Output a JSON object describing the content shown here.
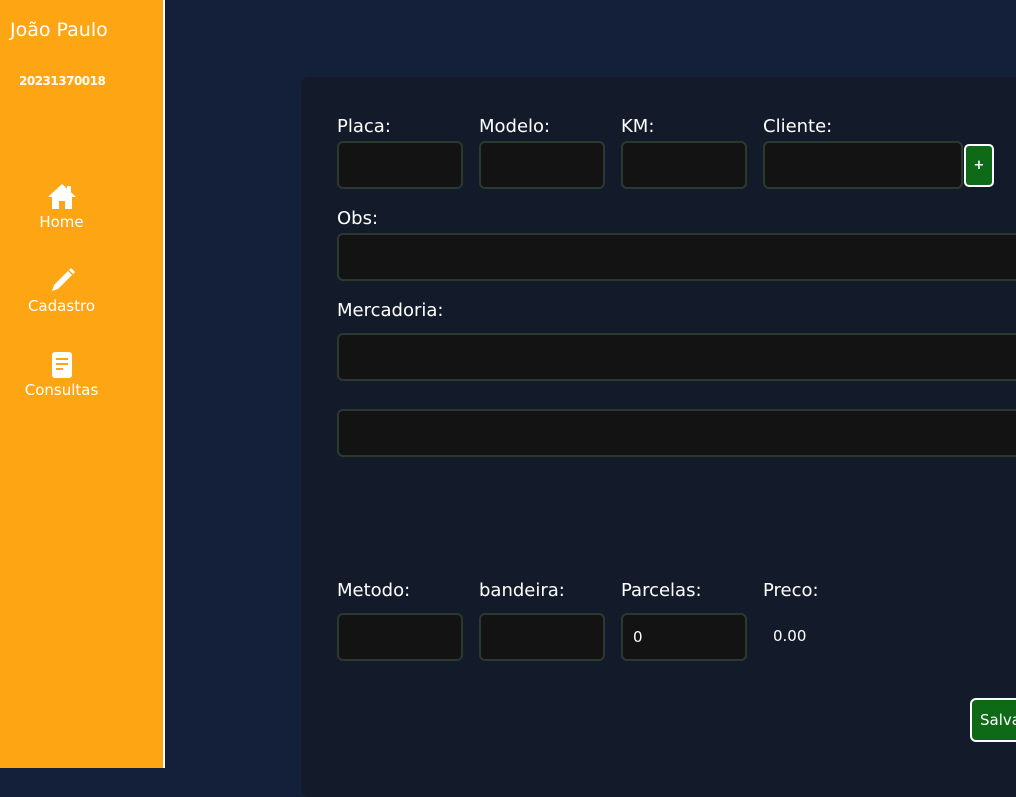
{
  "sidebar": {
    "user_name": "João Paulo",
    "user_id": "20231370018",
    "items": [
      {
        "label": "Home",
        "icon": "home-icon"
      },
      {
        "label": "Cadastro",
        "icon": "pencil-icon"
      },
      {
        "label": "Consultas",
        "icon": "document-icon"
      }
    ]
  },
  "form": {
    "placa_label": "Placa:",
    "modelo_label": "Modelo:",
    "km_label": "KM:",
    "cliente_label": "Cliente:",
    "add_client_button": "+",
    "obs_label": "Obs:",
    "mercadoria_label": "Mercadoria:",
    "metodo_label": "Metodo:",
    "bandeira_label": "bandeira:",
    "parcelas_label": "Parcelas:",
    "parcelas_value": "0",
    "preco_label": "Preco:",
    "preco_value": "0.00",
    "save_button": "Salvar"
  },
  "colors": {
    "sidebar_bg": "#fea513",
    "page_bg": "#142039",
    "card_bg": "#131a2a",
    "button_green": "#0f6a17"
  }
}
